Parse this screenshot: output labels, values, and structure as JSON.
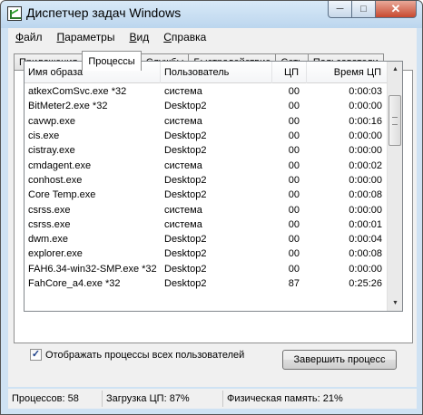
{
  "window": {
    "title": "Диспетчер задач Windows",
    "min": "─",
    "max": "□",
    "close": "✕"
  },
  "menu": [
    {
      "hot": "Ф",
      "rest": "айл"
    },
    {
      "hot": "П",
      "rest": "араметры"
    },
    {
      "hot": "В",
      "rest": "ид"
    },
    {
      "hot": "С",
      "rest": "правка"
    }
  ],
  "tabs": [
    "Приложения",
    "Процессы",
    "Службы",
    "Быстродействие",
    "Сеть",
    "Пользователи"
  ],
  "active_tab": "Процессы",
  "columns": {
    "image": "Имя образа",
    "user": "Пользователь",
    "cpu": "ЦП",
    "time": "Время ЦП"
  },
  "sort_indicator": "▲",
  "processes": [
    {
      "image": "atkexComSvc.exe *32",
      "user": "система",
      "cpu": "00",
      "time": "0:00:03"
    },
    {
      "image": "BitMeter2.exe *32",
      "user": "Desktop2",
      "cpu": "00",
      "time": "0:00:00"
    },
    {
      "image": "cavwp.exe",
      "user": "система",
      "cpu": "00",
      "time": "0:00:16"
    },
    {
      "image": "cis.exe",
      "user": "Desktop2",
      "cpu": "00",
      "time": "0:00:00"
    },
    {
      "image": "cistray.exe",
      "user": "Desktop2",
      "cpu": "00",
      "time": "0:00:00"
    },
    {
      "image": "cmdagent.exe",
      "user": "система",
      "cpu": "00",
      "time": "0:00:02"
    },
    {
      "image": "conhost.exe",
      "user": "Desktop2",
      "cpu": "00",
      "time": "0:00:00"
    },
    {
      "image": "Core Temp.exe",
      "user": "Desktop2",
      "cpu": "00",
      "time": "0:00:08"
    },
    {
      "image": "csrss.exe",
      "user": "система",
      "cpu": "00",
      "time": "0:00:00"
    },
    {
      "image": "csrss.exe",
      "user": "система",
      "cpu": "00",
      "time": "0:00:01"
    },
    {
      "image": "dwm.exe",
      "user": "Desktop2",
      "cpu": "00",
      "time": "0:00:04"
    },
    {
      "image": "explorer.exe",
      "user": "Desktop2",
      "cpu": "00",
      "time": "0:00:08"
    },
    {
      "image": "FAH6.34-win32-SMP.exe *32",
      "user": "Desktop2",
      "cpu": "00",
      "time": "0:00:00"
    },
    {
      "image": "FahCore_a4.exe *32",
      "user": "Desktop2",
      "cpu": "87",
      "time": "0:25:26"
    }
  ],
  "scrollbar": {
    "up": "▲",
    "down": "▼"
  },
  "show_all": {
    "checked": true,
    "check_glyph": "✓",
    "label": "Отображать процессы всех пользователей"
  },
  "end_process_button": "Завершить процесс",
  "status": {
    "processes": "Процессов: 58",
    "cpu_load": "Загрузка ЦП: 87%",
    "memory": "Физическая память: 21%"
  }
}
